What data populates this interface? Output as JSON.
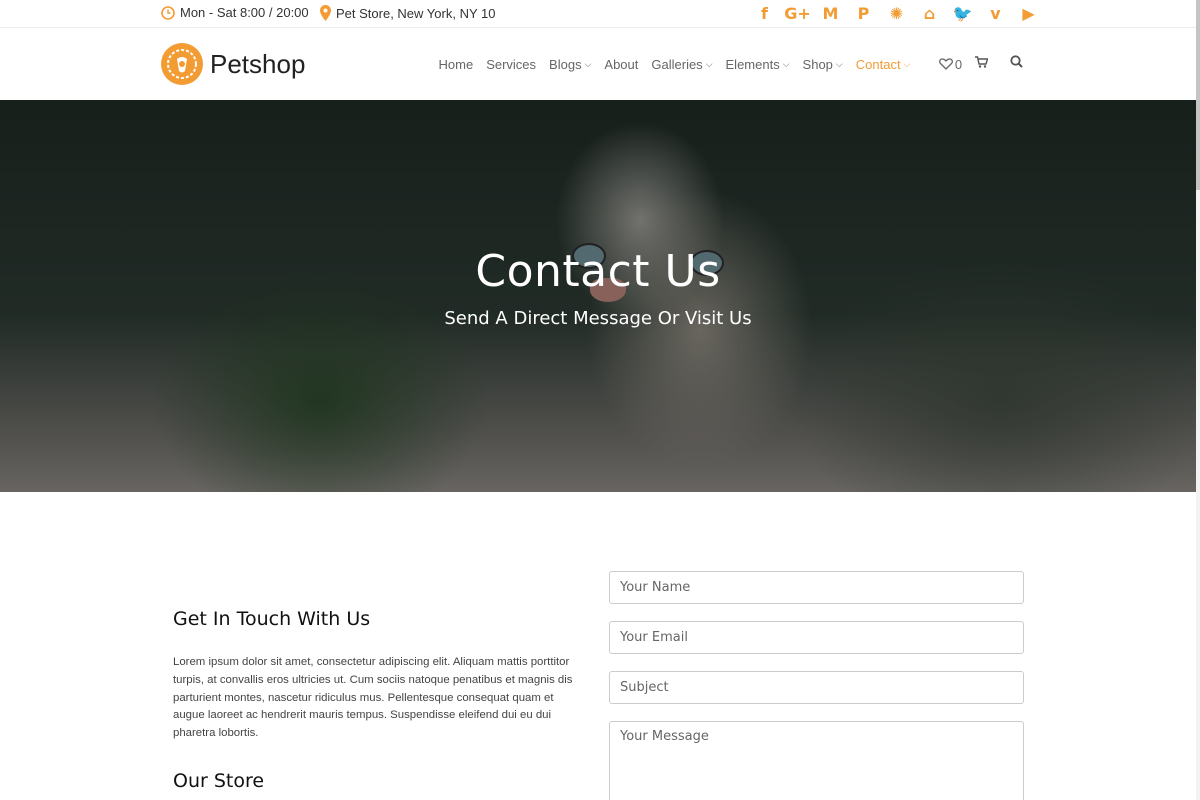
{
  "topbar": {
    "hours": "Mon - Sat 8:00 / 20:00",
    "address": "Pet Store, New York, NY 10",
    "social": [
      {
        "name": "facebook-icon",
        "glyph": "f"
      },
      {
        "name": "google-plus-icon",
        "glyph": "G+"
      },
      {
        "name": "gmail-icon",
        "glyph": "M"
      },
      {
        "name": "paypal-icon",
        "glyph": "P"
      },
      {
        "name": "joomla-icon",
        "glyph": "✺"
      },
      {
        "name": "twitch-icon",
        "glyph": "⌂"
      },
      {
        "name": "twitter-icon",
        "glyph": "🐦"
      },
      {
        "name": "vimeo-icon",
        "glyph": "v"
      },
      {
        "name": "youtube-icon",
        "glyph": "▶"
      }
    ]
  },
  "header": {
    "logo_text": "Petshop",
    "nav": [
      {
        "label": "Home",
        "dropdown": false,
        "active": false
      },
      {
        "label": "Services",
        "dropdown": false,
        "active": false
      },
      {
        "label": "Blogs",
        "dropdown": true,
        "active": false
      },
      {
        "label": "About",
        "dropdown": false,
        "active": false
      },
      {
        "label": "Galleries",
        "dropdown": true,
        "active": false
      },
      {
        "label": "Elements",
        "dropdown": true,
        "active": false
      },
      {
        "label": "Shop",
        "dropdown": true,
        "active": false
      },
      {
        "label": "Contact",
        "dropdown": true,
        "active": true
      }
    ],
    "wishlist_count": "0"
  },
  "hero": {
    "title": "Contact Us",
    "subtitle": "Send A Direct Message Or Visit Us"
  },
  "contact": {
    "heading": "Get In Touch With Us",
    "body": "Lorem ipsum dolor sit amet, consectetur adipiscing elit. Aliquam mattis porttitor turpis, at convallis eros ultricies ut. Cum sociis natoque penatibus et magnis dis parturient montes, nascetur ridiculus mus. Pellentesque consequat quam et augue laoreet ac hendrerit mauris tempus. Suspendisse eleifend dui eu dui pharetra lobortis.",
    "store_heading": "Our Store"
  },
  "form": {
    "name_placeholder": "Your Name",
    "email_placeholder": "Your Email",
    "subject_placeholder": "Subject",
    "message_placeholder": "Your Message"
  },
  "colors": {
    "accent": "#f39c34",
    "nav_text": "#666666"
  }
}
